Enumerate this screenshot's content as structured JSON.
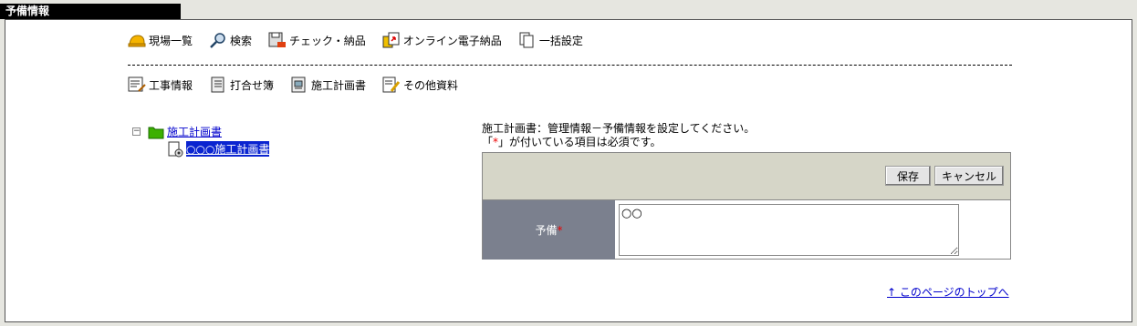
{
  "header": {
    "tab_title": "予備情報"
  },
  "toolbar1": [
    {
      "label": "現場一覧",
      "icon": "helmet-icon"
    },
    {
      "label": "検索",
      "icon": "magnifier-icon"
    },
    {
      "label": "チェック・納品",
      "icon": "floppy-check-icon"
    },
    {
      "label": "オンライン電子納品",
      "icon": "online-delivery-icon"
    },
    {
      "label": "一括設定",
      "icon": "documents-icon"
    }
  ],
  "toolbar2": [
    {
      "label": "工事情報",
      "icon": "construction-info-icon"
    },
    {
      "label": "打合せ簿",
      "icon": "notebook-icon"
    },
    {
      "label": "施工計画書",
      "icon": "plan-book-icon"
    },
    {
      "label": "その他資料",
      "icon": "document-pencil-icon"
    }
  ],
  "tree": {
    "expander": "−",
    "root_label": "施工計画書",
    "child_label": "○○○施工計画書"
  },
  "message": {
    "line1": "施工計画書：管理情報－予備情報を設定してください。",
    "line2_pre": "「",
    "line2_mark": "*",
    "line2_post": "」が付いている項目は必須です。"
  },
  "form": {
    "save_label": "保存",
    "cancel_label": "キャンセル",
    "field_label": "予備",
    "required_mark": "*",
    "field_value": "○○"
  },
  "footer": {
    "toplink": "↑ このページのトップへ"
  }
}
